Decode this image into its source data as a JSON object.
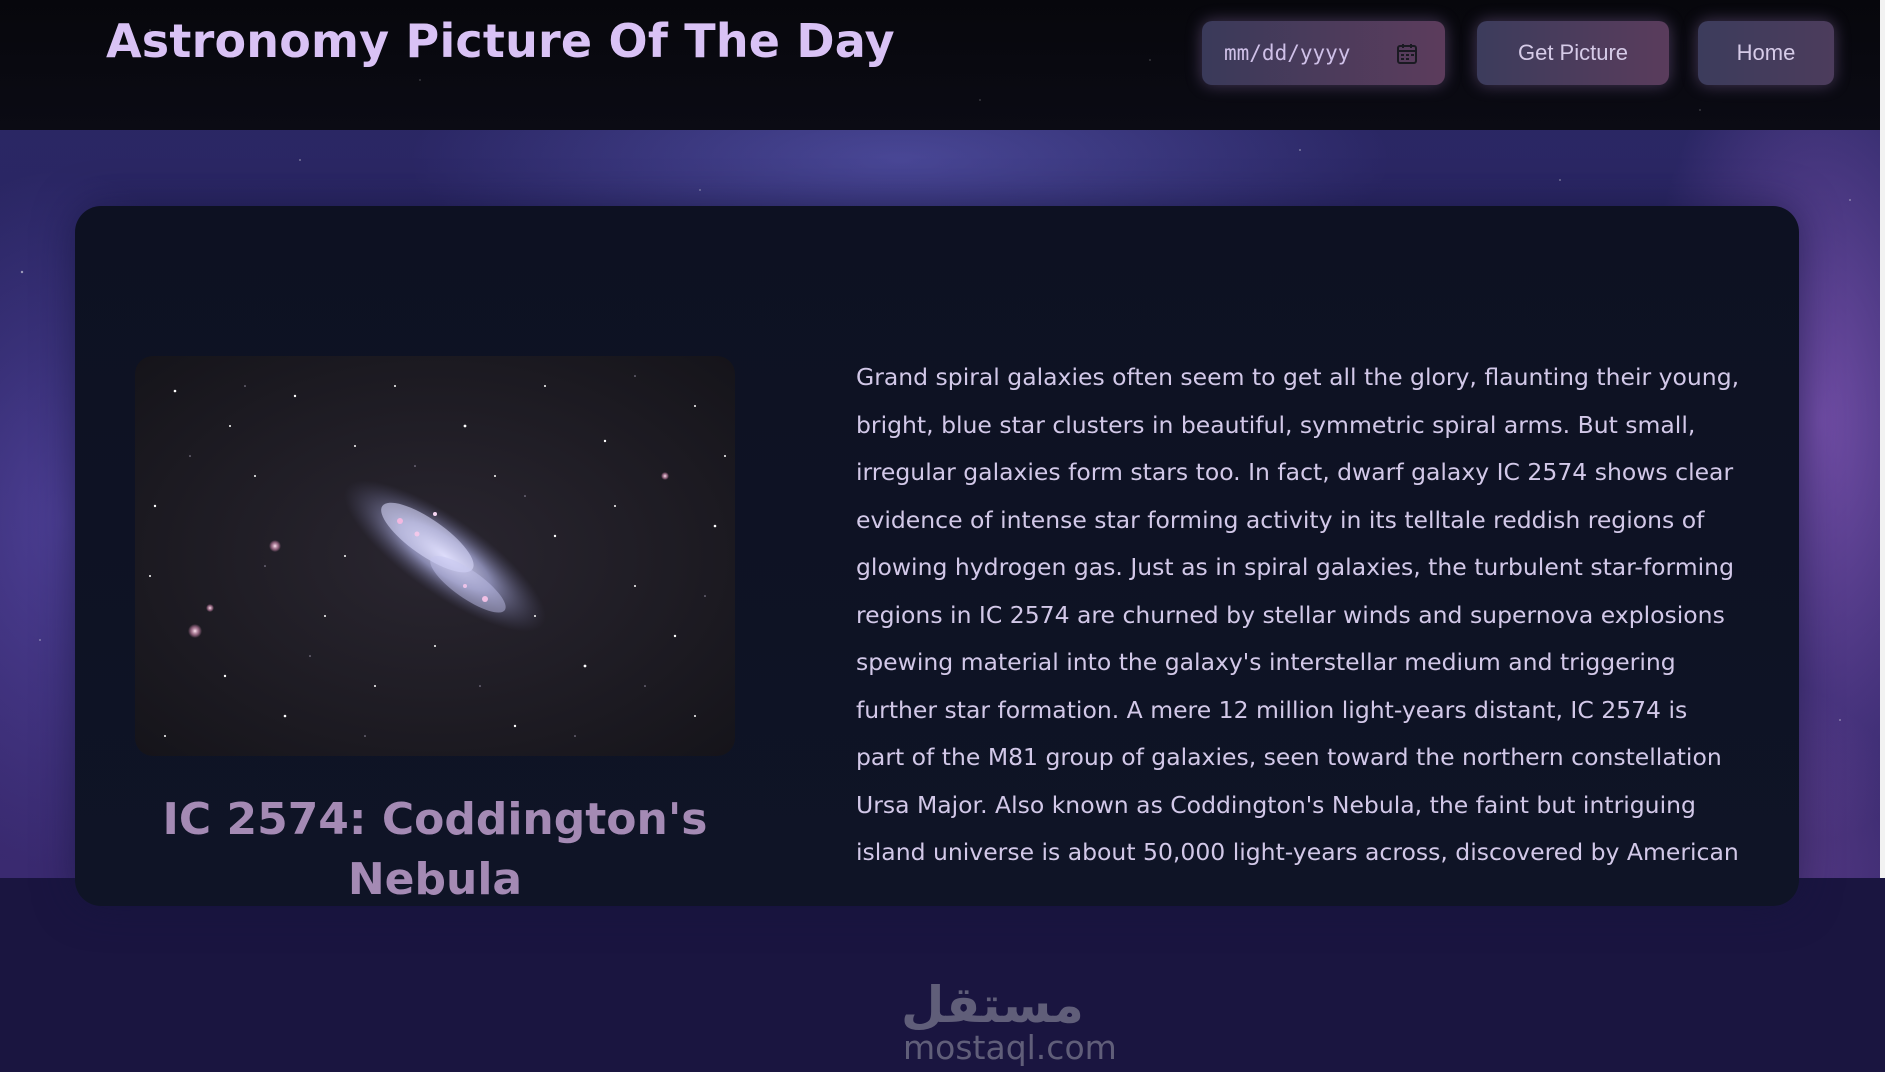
{
  "header": {
    "title": "Astronomy Picture Of The Day",
    "date_input": {
      "placeholder": "mm/dd/yyyy",
      "value": "",
      "icon": "calendar-icon"
    },
    "get_picture_label": "Get Picture",
    "home_label": "Home"
  },
  "apod": {
    "title": "IC 2574: Coddington's Nebula",
    "image_alt": "Dwarf galaxy IC 2574 among foreground stars",
    "explanation": "Grand spiral galaxies often seem to get all the glory, flaunting their young, bright, blue star clusters in beautiful, symmetric spiral arms. But small, irregular galaxies form stars too. In fact, dwarf galaxy IC 2574 shows clear evidence of intense star forming activity in its telltale reddish regions of glowing hydrogen gas. Just as in spiral galaxies, the turbulent star-forming regions in IC 2574 are churned by stellar winds and supernova explosions spewing material into the galaxy's interstellar medium and triggering further star formation. A mere 12 million light-years distant, IC 2574 is part of the M81 group of galaxies, seen toward the northern constellation Ursa Major. Also known as Coddington's Nebula, the faint but intriguing island universe is about 50,000 light-years across, discovered by American"
  },
  "watermark": {
    "arabic": "مستقل",
    "latin": "mostaql.com"
  },
  "colors": {
    "title": "#d9c2f5",
    "card_bg": "#0d1122",
    "text": "#d2c8e8",
    "picture_title": "#a48ab4"
  }
}
